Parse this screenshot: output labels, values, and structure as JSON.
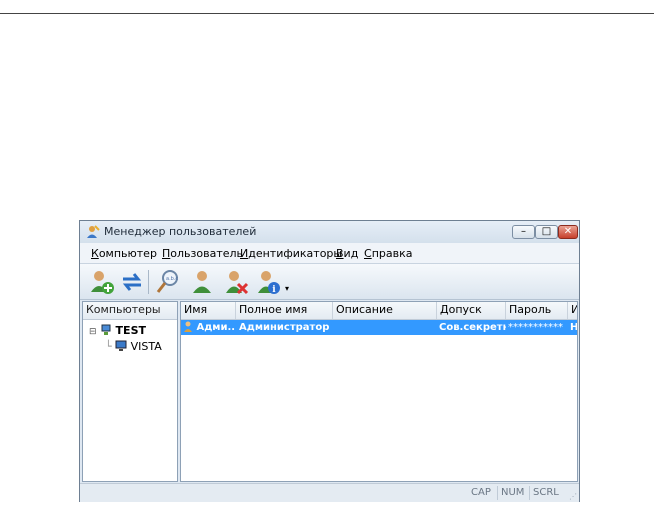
{
  "window": {
    "title": "Менеджер пользователей"
  },
  "menu": [
    {
      "u": "К",
      "rest": "омпьютер"
    },
    {
      "u": "П",
      "rest": "ользователь"
    },
    {
      "u": "И",
      "rest": "дентификаторы"
    },
    {
      "u": "В",
      "rest": "ид"
    },
    {
      "u": "С",
      "rest": "правка"
    }
  ],
  "toolbar": {
    "icons": [
      "add-user-icon",
      "refresh-icon",
      "find-user-icon",
      "user-icon",
      "delete-user-icon",
      "user-properties-icon"
    ]
  },
  "tree": {
    "header": "Компьютеры",
    "root": "TEST",
    "child": "VISTA"
  },
  "list": {
    "columns": [
      "Имя",
      "Полное имя",
      "Описание",
      "Допуск",
      "Пароль",
      "И"
    ],
    "rows": [
      {
        "name": "Адми...",
        "full_name": "Администратор",
        "description": "",
        "access": "Сов.секретно",
        "password": "***********",
        "extra": "Н"
      }
    ]
  },
  "status": {
    "cap": "CAP",
    "num": "NUM",
    "scrl": "SCRL"
  }
}
